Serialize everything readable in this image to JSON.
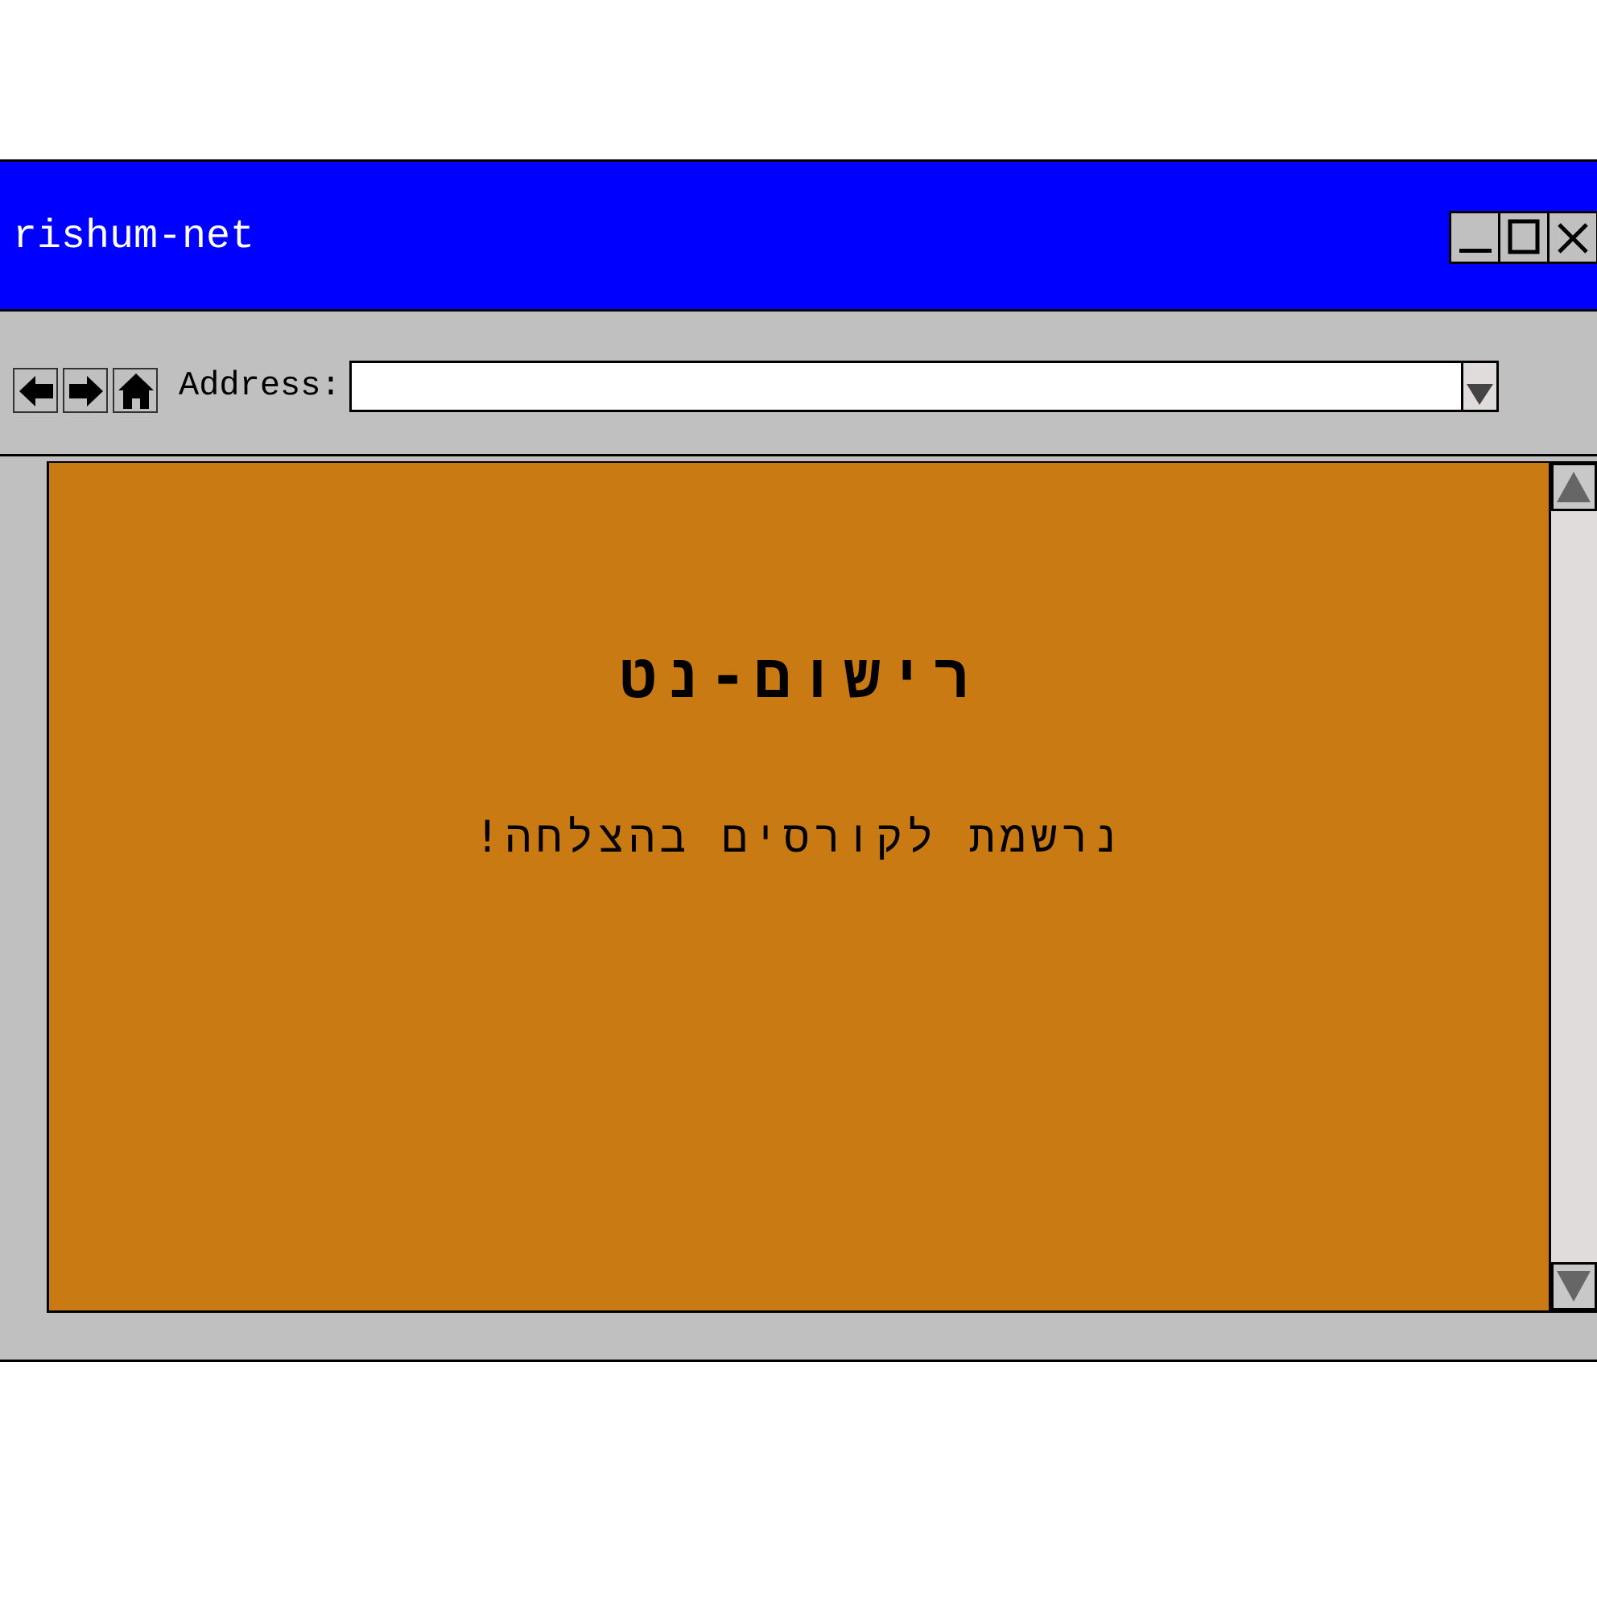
{
  "window": {
    "title": "rishum-net",
    "controls": {
      "minimize_icon": "minimize-icon",
      "maximize_icon": "maximize-icon",
      "close_icon": "close-icon"
    }
  },
  "toolbar": {
    "nav_icons": [
      "back-arrow-icon",
      "forward-arrow-icon",
      "home-icon"
    ],
    "address_label": "Address:",
    "address_value": "",
    "dropdown_icon": "chevron-down-icon"
  },
  "page": {
    "title": "רישום-נט",
    "message": "נרשמת לקורסים בהצלחה!",
    "background_color": "#c97a12"
  },
  "colors": {
    "titlebar": "#0000ff",
    "chrome": "#c0c0c0",
    "scrollbar_track": "#e0dcdc"
  }
}
